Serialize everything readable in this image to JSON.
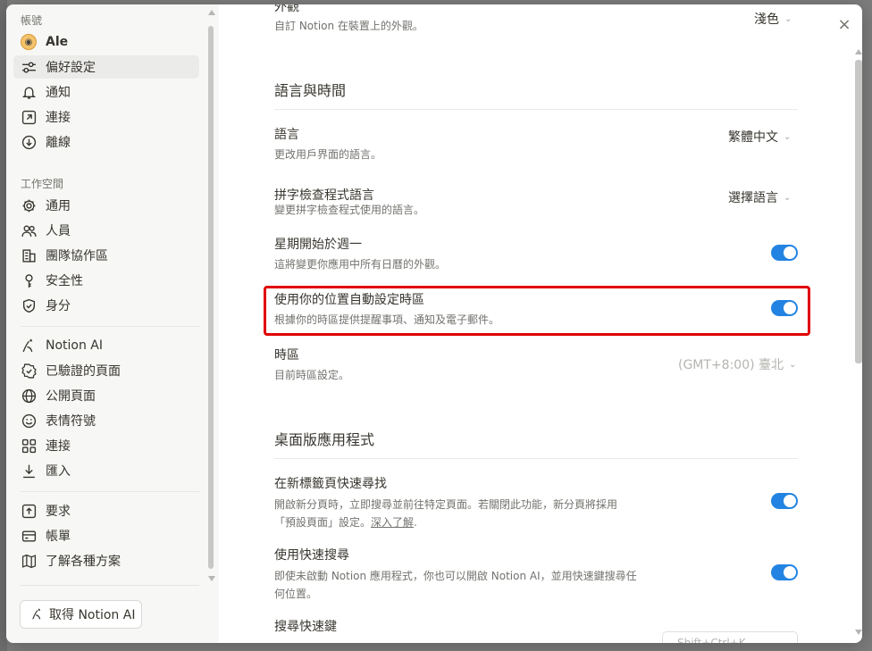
{
  "sidebar": {
    "account_label": "帳號",
    "user_name": "Ale",
    "account_items": [
      {
        "label": "偏好設定",
        "icon": "sliders-icon"
      },
      {
        "label": "通知",
        "icon": "bell-icon"
      },
      {
        "label": "連接",
        "icon": "arrow-up-right-icon"
      },
      {
        "label": "離線",
        "icon": "download-circle-icon"
      }
    ],
    "workspace_label": "工作空間",
    "workspace_items": [
      {
        "label": "通用",
        "icon": "gear-icon"
      },
      {
        "label": "人員",
        "icon": "people-icon"
      },
      {
        "label": "團隊協作區",
        "icon": "building-icon"
      },
      {
        "label": "安全性",
        "icon": "key-icon"
      },
      {
        "label": "身分",
        "icon": "shield-check-icon"
      }
    ],
    "feature_items": [
      {
        "label": "Notion AI",
        "icon": "notion-ai-icon"
      },
      {
        "label": "已驗證的頁面",
        "icon": "verified-badge-icon"
      },
      {
        "label": "公開頁面",
        "icon": "globe-icon"
      },
      {
        "label": "表情符號",
        "icon": "smile-icon"
      },
      {
        "label": "連接",
        "icon": "grid-icon"
      },
      {
        "label": "匯入",
        "icon": "import-icon"
      }
    ],
    "billing_items": [
      {
        "label": "要求",
        "icon": "upload-box-icon"
      },
      {
        "label": "帳單",
        "icon": "card-icon"
      },
      {
        "label": "了解各種方案",
        "icon": "map-icon"
      }
    ],
    "get_ai_label": "取得 Notion AI"
  },
  "main": {
    "appearance": {
      "title": "外觀",
      "desc": "自訂 Notion 在裝置上的外觀。",
      "value": "淺色"
    },
    "lang_time_heading": "語言與時間",
    "language": {
      "title": "語言",
      "desc": "更改用戶界面的語言。",
      "value": "繁體中文"
    },
    "spellcheck": {
      "title": "拼字檢查程式語言",
      "desc": "變更拼字檢查程式使用的語言。",
      "value": "選擇語言"
    },
    "week_start": {
      "title": "星期開始於週一",
      "desc": "這將變更你應用中所有日曆的外觀。",
      "enabled": true
    },
    "auto_timezone": {
      "title": "使用你的位置自動設定時區",
      "desc": "根據你的時區提供提醒事項、通知及電子郵件。",
      "enabled": true
    },
    "timezone": {
      "title": "時區",
      "desc": "目前時區設定。",
      "value": "(GMT+8:00) 臺北"
    },
    "desktop_heading": "桌面版應用程式",
    "new_tab_search": {
      "title": "在新標籤頁快速尋找",
      "desc_line1": "開啟新分頁時，立即搜尋並前往特定頁面。若關閉此功能，新分頁將採用",
      "desc_line2": "「預設頁面」設定。",
      "link": "深入了解",
      "desc_end": ".",
      "enabled": true
    },
    "quick_search": {
      "title": "使用快速搜尋",
      "desc_line1": "即使未啟動 Notion 應用程式，你也可以開啟 Notion AI，並用快速鍵搜尋任",
      "desc_line2": "何位置。",
      "enabled": true
    },
    "search_shortcut": {
      "title": "搜尋快速鍵",
      "value": "Shift+Ctrl+K"
    }
  },
  "colors": {
    "toggle_on": "#2383e2",
    "highlight": "#e00000"
  }
}
